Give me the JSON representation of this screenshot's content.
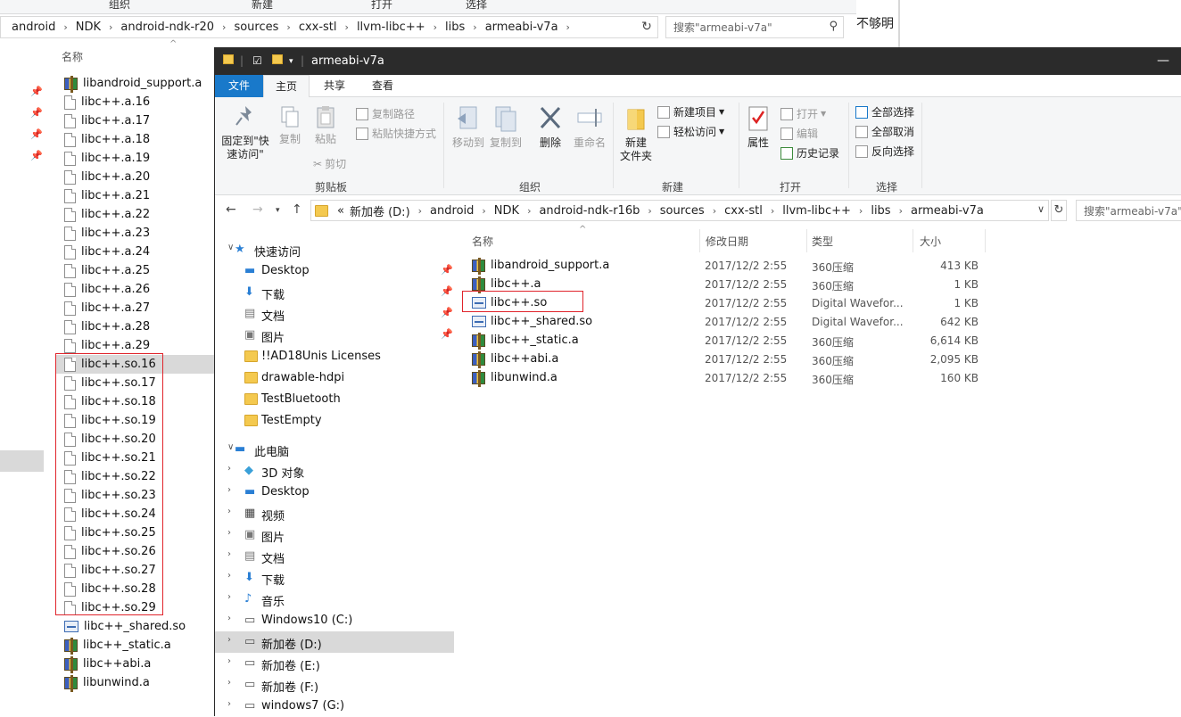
{
  "back_window": {
    "ribbon_strip": [
      "组织",
      "新建",
      "打开",
      "选择"
    ],
    "address": [
      "android",
      "NDK",
      "android-ndk-r20",
      "sources",
      "cxx-stl",
      "llvm-libc++",
      "libs",
      "armeabi-v7a"
    ],
    "search_placeholder": "搜索\"armeabi-v7a\"",
    "column_name": "名称",
    "files": [
      {
        "name": "libandroid_support.a",
        "icon": "zip"
      },
      {
        "name": "libc++.a.16",
        "icon": "doc"
      },
      {
        "name": "libc++.a.17",
        "icon": "doc"
      },
      {
        "name": "libc++.a.18",
        "icon": "doc"
      },
      {
        "name": "libc++.a.19",
        "icon": "doc"
      },
      {
        "name": "libc++.a.20",
        "icon": "doc"
      },
      {
        "name": "libc++.a.21",
        "icon": "doc"
      },
      {
        "name": "libc++.a.22",
        "icon": "doc"
      },
      {
        "name": "libc++.a.23",
        "icon": "doc"
      },
      {
        "name": "libc++.a.24",
        "icon": "doc"
      },
      {
        "name": "libc++.a.25",
        "icon": "doc"
      },
      {
        "name": "libc++.a.26",
        "icon": "doc"
      },
      {
        "name": "libc++.a.27",
        "icon": "doc"
      },
      {
        "name": "libc++.a.28",
        "icon": "doc"
      },
      {
        "name": "libc++.a.29",
        "icon": "doc"
      },
      {
        "name": "libc++.so.16",
        "icon": "doc"
      },
      {
        "name": "libc++.so.17",
        "icon": "doc"
      },
      {
        "name": "libc++.so.18",
        "icon": "doc"
      },
      {
        "name": "libc++.so.19",
        "icon": "doc"
      },
      {
        "name": "libc++.so.20",
        "icon": "doc"
      },
      {
        "name": "libc++.so.21",
        "icon": "doc"
      },
      {
        "name": "libc++.so.22",
        "icon": "doc"
      },
      {
        "name": "libc++.so.23",
        "icon": "doc"
      },
      {
        "name": "libc++.so.24",
        "icon": "doc"
      },
      {
        "name": "libc++.so.25",
        "icon": "doc"
      },
      {
        "name": "libc++.so.26",
        "icon": "doc"
      },
      {
        "name": "libc++.so.27",
        "icon": "doc"
      },
      {
        "name": "libc++.so.28",
        "icon": "doc"
      },
      {
        "name": "libc++.so.29",
        "icon": "doc"
      },
      {
        "name": "libc++_shared.so",
        "icon": "so"
      },
      {
        "name": "libc++_static.a",
        "icon": "zip"
      },
      {
        "name": "libc++abi.a",
        "icon": "zip"
      },
      {
        "name": "libunwind.a",
        "icon": "zip"
      }
    ]
  },
  "doc_fragment": "不够明",
  "window": {
    "title": "armeabi-v7a",
    "minimize": "—"
  },
  "tabs": {
    "file": "文件",
    "home": "主页",
    "share": "共享",
    "view": "查看"
  },
  "ribbon": {
    "pin_quick": "固定到\"快\n速访问\"",
    "copy": "复制",
    "paste": "粘贴",
    "copy_path": "复制路径",
    "paste_shortcut": "粘贴快捷方式",
    "cut": "剪切",
    "group_clipboard": "剪贴板",
    "move_to": "移动到",
    "copy_to": "复制到",
    "delete": "删除",
    "rename": "重命名",
    "group_organize": "组织",
    "new_folder": "新建\n文件夹",
    "new_item": "新建项目",
    "easy_access": "轻松访问",
    "group_new": "新建",
    "properties": "属性",
    "open": "打开",
    "edit": "编辑",
    "history": "历史记录",
    "group_open": "打开",
    "select_all": "全部选择",
    "select_none": "全部取消",
    "invert_select": "反向选择",
    "group_select": "选择"
  },
  "address": {
    "prefix": "«",
    "crumbs": [
      "新加卷 (D:)",
      "android",
      "NDK",
      "android-ndk-r16b",
      "sources",
      "cxx-stl",
      "llvm-libc++",
      "libs",
      "armeabi-v7a"
    ],
    "search_placeholder": "搜索\"armeabi-v7a\""
  },
  "nav": {
    "quick_access": "快速访问",
    "quick_items": [
      {
        "label": "Desktop",
        "icon": "desktop",
        "pinned": true
      },
      {
        "label": "下载",
        "icon": "download",
        "pinned": true
      },
      {
        "label": "文档",
        "icon": "documents",
        "pinned": true
      },
      {
        "label": "图片",
        "icon": "pictures",
        "pinned": true
      },
      {
        "label": "!!AD18Unis Licenses",
        "icon": "folder",
        "pinned": false
      },
      {
        "label": "drawable-hdpi",
        "icon": "folder",
        "pinned": false
      },
      {
        "label": "TestBluetooth",
        "icon": "folder",
        "pinned": false
      },
      {
        "label": "TestEmpty",
        "icon": "folder",
        "pinned": false
      }
    ],
    "this_pc": "此电脑",
    "pc_items": [
      {
        "label": "3D 对象",
        "icon": "3d-objects"
      },
      {
        "label": "Desktop",
        "icon": "desktop"
      },
      {
        "label": "视频",
        "icon": "videos"
      },
      {
        "label": "图片",
        "icon": "pictures"
      },
      {
        "label": "文档",
        "icon": "documents"
      },
      {
        "label": "下载",
        "icon": "download"
      },
      {
        "label": "音乐",
        "icon": "music"
      },
      {
        "label": "Windows10 (C:)",
        "icon": "drive"
      },
      {
        "label": "新加卷 (D:)",
        "icon": "drive",
        "selected": true
      },
      {
        "label": "新加卷 (E:)",
        "icon": "drive"
      },
      {
        "label": "新加卷 (F:)",
        "icon": "drive"
      },
      {
        "label": "windows7 (G:)",
        "icon": "drive"
      }
    ]
  },
  "columns": {
    "name": "名称",
    "modified": "修改日期",
    "type": "类型",
    "size": "大小"
  },
  "files": [
    {
      "name": "libandroid_support.a",
      "date": "2017/12/2 2:55",
      "type": "360压缩",
      "size": "413 KB",
      "icon": "zip"
    },
    {
      "name": "libc++.a",
      "date": "2017/12/2 2:55",
      "type": "360压缩",
      "size": "1 KB",
      "icon": "zip"
    },
    {
      "name": "libc++.so",
      "date": "2017/12/2 2:55",
      "type": "Digital Wavefor...",
      "size": "1 KB",
      "icon": "so"
    },
    {
      "name": "libc++_shared.so",
      "date": "2017/12/2 2:55",
      "type": "Digital Wavefor...",
      "size": "642 KB",
      "icon": "so"
    },
    {
      "name": "libc++_static.a",
      "date": "2017/12/2 2:55",
      "type": "360压缩",
      "size": "6,614 KB",
      "icon": "zip"
    },
    {
      "name": "libc++abi.a",
      "date": "2017/12/2 2:55",
      "type": "360压缩",
      "size": "2,095 KB",
      "icon": "zip"
    },
    {
      "name": "libunwind.a",
      "date": "2017/12/2 2:55",
      "type": "360压缩",
      "size": "160 KB",
      "icon": "zip"
    }
  ],
  "colors": {
    "accent": "#1979ca",
    "highlight_box": "#e0242b",
    "titlebar": "#2b2b2b",
    "selection": "#d9d9d9"
  }
}
